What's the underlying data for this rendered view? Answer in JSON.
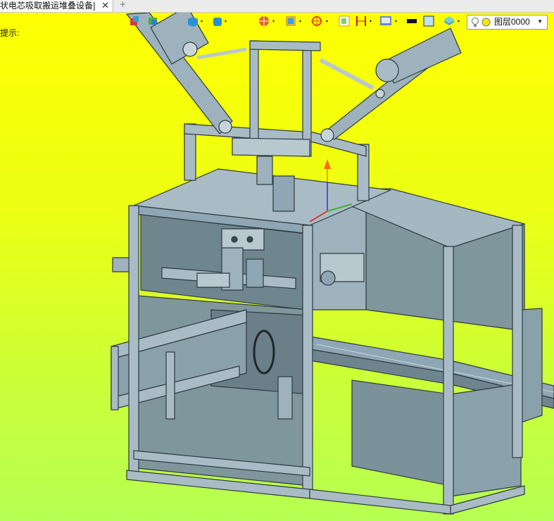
{
  "tabs": [
    {
      "title": "状电芯吸取搬运堆叠设备]",
      "close_glyph": "✕"
    }
  ],
  "new_tab_glyph": "+",
  "status_hint": "提示:",
  "toolbar": {
    "tools": [
      "insert-part-icon",
      "align-icon",
      "box-shape-icon",
      "cylinder-shape-icon",
      "render-style-icon",
      "view-mode-icon",
      "coordinate-icon",
      "section-icon",
      "dimension-icon",
      "display-settings-icon",
      "line-color-icon",
      "fill-color-icon",
      "layer-stack-icon"
    ],
    "layer": {
      "name": "图层0000",
      "visible_icon": "light-bulb-icon",
      "color_icon": "yellow-dot-icon"
    }
  },
  "colors": {
    "bg_top": "#ffff00",
    "bg_bottom": "#b6ff52",
    "frame": "#8fa6b4",
    "panel": "#7f969d",
    "edge": "#2e3a40"
  }
}
